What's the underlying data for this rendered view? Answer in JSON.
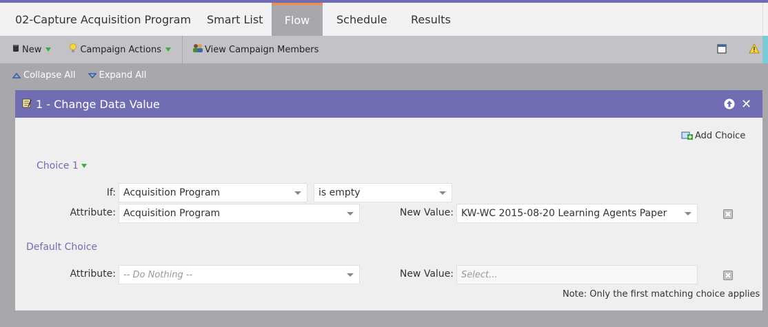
{
  "tabs": {
    "program": "02-Capture Acquisition Program",
    "smart_list": "Smart List",
    "flow": "Flow",
    "schedule": "Schedule",
    "results": "Results"
  },
  "toolbar": {
    "new_label": "New",
    "campaign_actions_label": "Campaign Actions",
    "view_members_label": "View Campaign Members"
  },
  "flow_controls": {
    "collapse_all": "Collapse All",
    "expand_all": "Expand All"
  },
  "step": {
    "title": "1 - Change Data Value",
    "add_choice": "Add Choice",
    "choice_label": "Choice 1",
    "if_label": "If:",
    "if_field": "Acquisition Program",
    "if_operator": "is empty",
    "attribute_label": "Attribute:",
    "attribute_value": "Acquisition Program",
    "new_value_label": "New Value:",
    "new_value": "KW-WC 2015-08-20 Learning Agents Paper",
    "default_label": "Default Choice",
    "default_attribute_label": "Attribute:",
    "default_attribute_placeholder": "-- Do Nothing --",
    "default_new_value_label": "New Value:",
    "default_new_value_placeholder": "Select...",
    "note": "Note: Only the first matching choice applies"
  },
  "colors": {
    "accent_purple": "#716db3",
    "active_tab_border": "#f58b3f",
    "toolbar_bg": "#c3c3c7",
    "canvas_bg": "#a8a8ac"
  },
  "icons": [
    "new-icon",
    "lightbulb-icon",
    "members-icon",
    "window-icon",
    "warning-icon",
    "collapse-icon",
    "expand-icon",
    "flow-step-icon",
    "move-up-icon",
    "close-icon",
    "add-choice-icon",
    "delete-icon"
  ]
}
